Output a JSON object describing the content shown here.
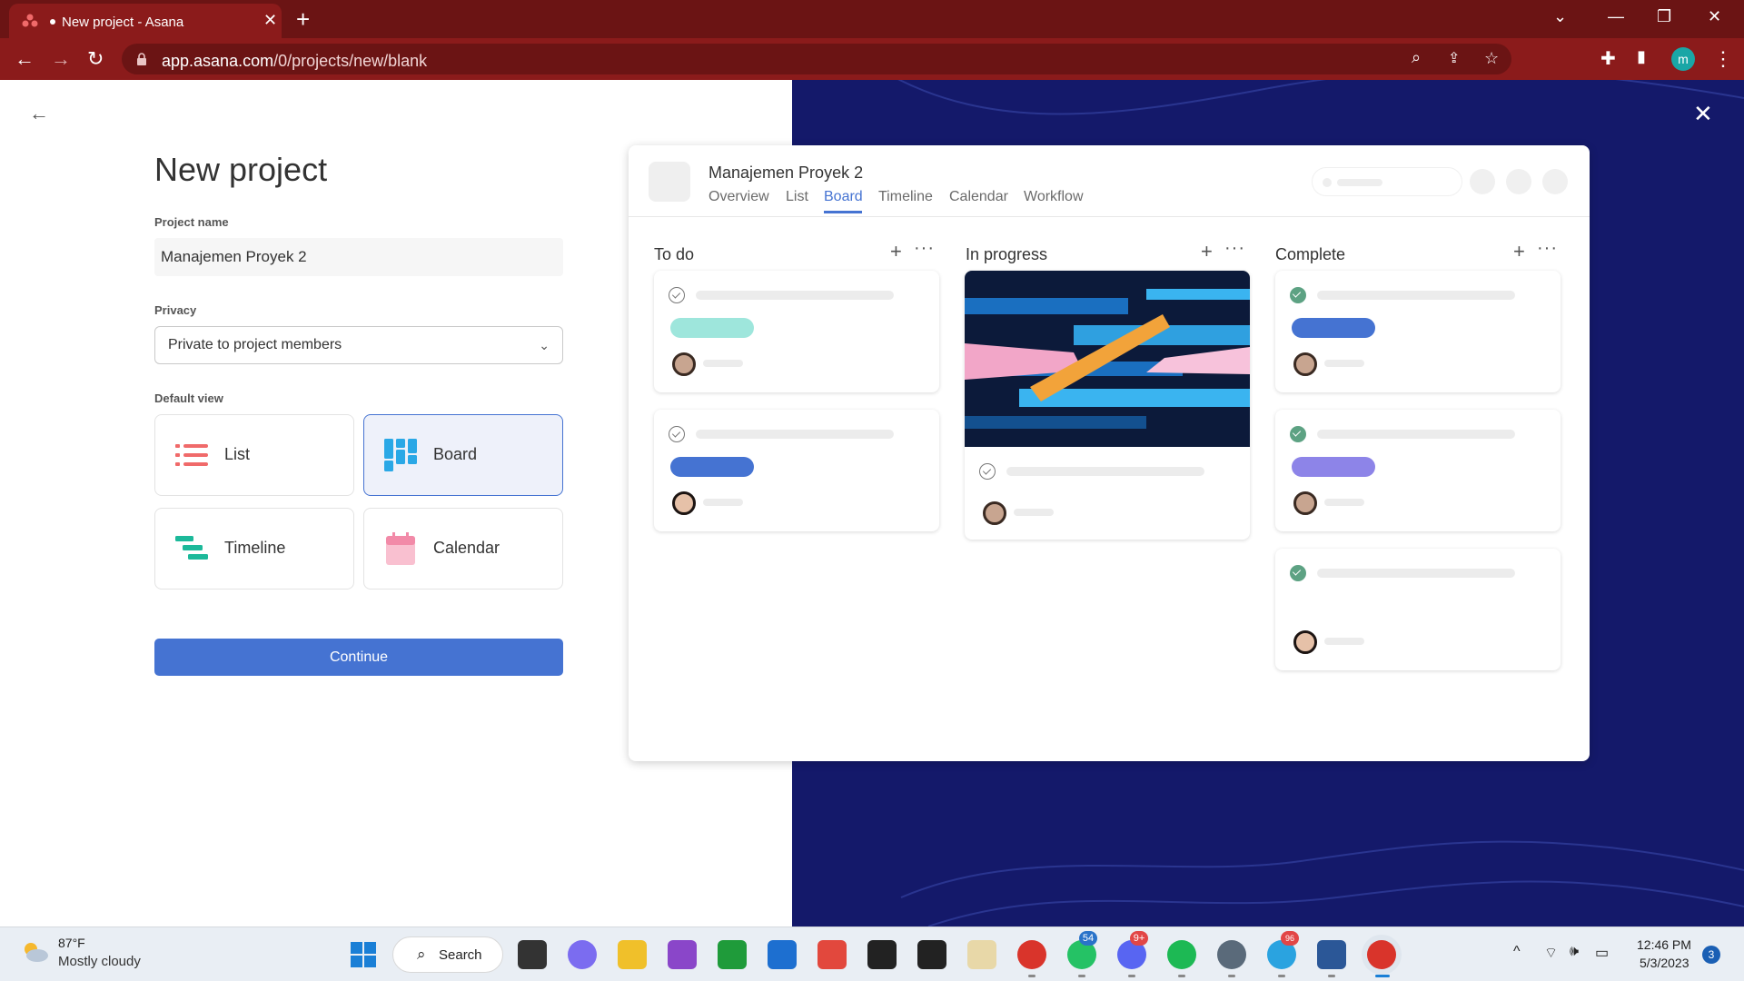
{
  "browser": {
    "tab_title": "New project - Asana",
    "url_host": "app.asana.com",
    "url_path": "/0/projects/new/blank",
    "profile_initial": "m"
  },
  "form": {
    "title": "New project",
    "project_name_label": "Project name",
    "project_name_value": "Manajemen Proyek 2",
    "privacy_label": "Privacy",
    "privacy_value": "Private to project members",
    "default_view_label": "Default view",
    "views": [
      {
        "label": "List",
        "icon": "list-icon"
      },
      {
        "label": "Board",
        "icon": "board-icon",
        "selected": true
      },
      {
        "label": "Timeline",
        "icon": "timeline-icon"
      },
      {
        "label": "Calendar",
        "icon": "calendar-icon"
      }
    ],
    "continue_label": "Continue"
  },
  "preview": {
    "project_name": "Manajemen Proyek 2",
    "tabs": [
      "Overview",
      "List",
      "Board",
      "Timeline",
      "Calendar",
      "Workflow"
    ],
    "active_tab": "Board",
    "columns": [
      "To do",
      "In progress",
      "Complete"
    ],
    "plus": "+",
    "more": "···"
  },
  "taskbar": {
    "weather_temp": "87°F",
    "weather_desc": "Mostly cloudy",
    "search_label": "Search",
    "whatsapp_badge": "54",
    "discord_badge": "9+",
    "telegram_badge": "96",
    "time": "12:46 PM",
    "date": "5/3/2023",
    "notifications": "3"
  },
  "colors": {
    "brand_blue": "#4573d2",
    "chrome_red": "#8b1b1b",
    "panel_navy": "#14196a"
  }
}
